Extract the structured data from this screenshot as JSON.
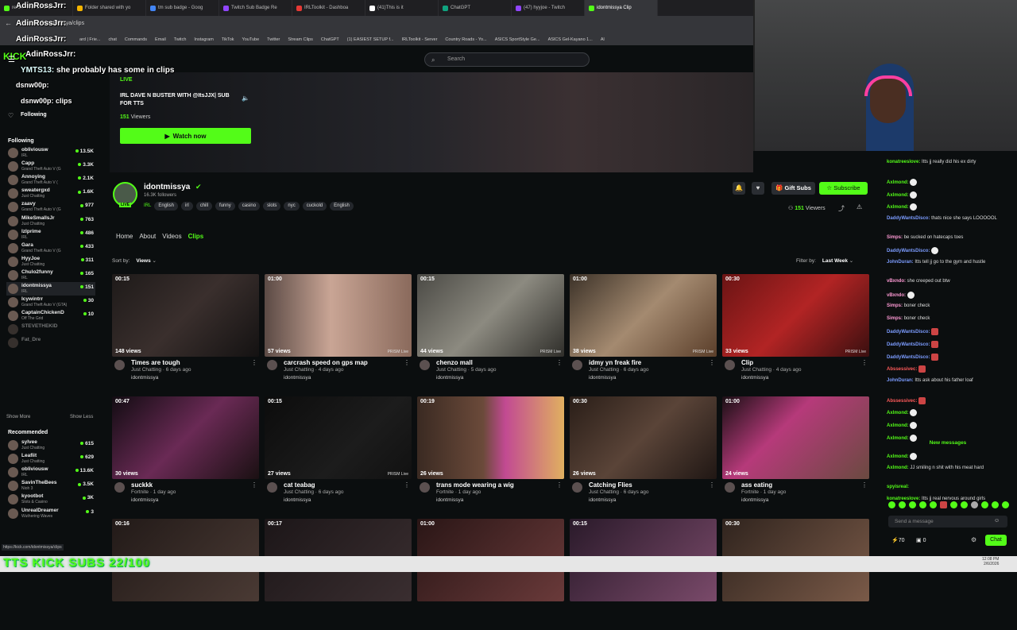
{
  "browser": {
    "tabs": [
      {
        "label": "ream - Kick Dashb",
        "color": "#53fc18"
      },
      {
        "label": "Folder shared with yo",
        "color": "#f4b400"
      },
      {
        "label": "tm sub badge - Goog",
        "color": "#4285f4"
      },
      {
        "label": "Twitch Sub Badge Re",
        "color": "#9146ff"
      },
      {
        "label": "IRLToolkit - Dashboa",
        "color": "#e53935"
      },
      {
        "label": "(41)This is it",
        "color": "#ffffff"
      },
      {
        "label": "ChatGPT",
        "color": "#10a37f"
      },
      {
        "label": "(47) hyyjoe - Twitch",
        "color": "#9146ff"
      },
      {
        "label": "idontmissya Clip",
        "color": "#53fc18"
      }
    ],
    "url": "kick.com/idontmissya/clips",
    "bookmarks": [
      "ard | Frie...",
      "chat",
      "Commands",
      "Email",
      "Twitch",
      "Instagram",
      "TikTok",
      "YouTube",
      "Twitter",
      "Stream Clips",
      "ChatGPT",
      "(1) EASIEST SETUP f...",
      "IRLToolkit - Server",
      "Country Roads - Yo...",
      "ASICS SportStyle Ge...",
      "ASICS Gel-Kayano 1...",
      "Al"
    ]
  },
  "overlay": {
    "alerts": [
      "AdinRossJrr:",
      "AdinRossJrr:",
      "AdinRossJrr:"
    ],
    "chat_user": "YMTS13:",
    "chat_text": "she probably has some in clips",
    "line2_user": "dsnw00p:",
    "line2_text": "clips",
    "kick_logo": "KICK",
    "banner": "TTS KICK SUBS 22/100"
  },
  "search": {
    "placeholder": "Search"
  },
  "sidebar": {
    "followed_label": "Following",
    "section_following": "Following",
    "following": [
      {
        "name": "obliviousw",
        "game": "IRL",
        "viewers": "13.5K"
      },
      {
        "name": "Capp",
        "game": "Grand Theft Auto V (G",
        "viewers": "3.3K"
      },
      {
        "name": "Annoying",
        "game": "Grand Theft Auto V (",
        "viewers": "2.1K"
      },
      {
        "name": "sweatergxd",
        "game": "Just Chatting",
        "viewers": "1.6K"
      },
      {
        "name": "zaavy",
        "game": "Grand Theft Auto V (G",
        "viewers": "977"
      },
      {
        "name": "MikeSmallsJr",
        "game": "Just Chatting",
        "viewers": "763"
      },
      {
        "name": "lzIprime",
        "game": "IRL",
        "viewers": "486"
      },
      {
        "name": "Gara",
        "game": "Grand Theft Auto V (G",
        "viewers": "433"
      },
      {
        "name": "HyyJoe",
        "game": "Just Chatting",
        "viewers": "311"
      },
      {
        "name": "Chulo2funny",
        "game": "IRL",
        "viewers": "165"
      },
      {
        "name": "idontmissya",
        "game": "IRL",
        "viewers": "151"
      },
      {
        "name": "Icywintrr",
        "game": "Grand Theft Auto V (GTA)",
        "viewers": "30"
      },
      {
        "name": "CaptainChickenD",
        "game": "Off The Grid",
        "viewers": "10"
      },
      {
        "name": "STEVETHEKID",
        "game": "",
        "viewers": ""
      },
      {
        "name": "Fat_Dre",
        "game": "",
        "viewers": ""
      }
    ],
    "show_more": "Show More",
    "show_less": "Show Less",
    "section_recommended": "Recommended",
    "recommended": [
      {
        "name": "sylvee",
        "game": "Just Chatting",
        "viewers": "615"
      },
      {
        "name": "Leafiit",
        "game": "Just Chatting",
        "viewers": "629"
      },
      {
        "name": "obliviousw",
        "game": "IRL",
        "viewers": "13.6K"
      },
      {
        "name": "SavinTheBees",
        "game": "Nioh 3",
        "viewers": "3.5K"
      },
      {
        "name": "kyootbot",
        "game": "Slots & Casino",
        "viewers": "3K"
      },
      {
        "name": "UnrealDreamer",
        "game": "Wuthering Waves",
        "viewers": "3"
      }
    ],
    "status_url": "https://kick.com/idontmissya/clips"
  },
  "hero": {
    "live_label": "LIVE",
    "title": "IRL DAVE N BUSTER WITH @ItsJJX| SUB FOR TTS",
    "viewers": "151",
    "viewers_label": "Viewers",
    "watch_label": "Watch now"
  },
  "channel": {
    "name": "idontmissya",
    "followers": "16.3K followers",
    "category": "IRL",
    "tags": [
      "English",
      "irl",
      "chill",
      "funny",
      "casino",
      "slots",
      "nyc",
      "cuckold",
      "English"
    ],
    "avatar_live": "LIVE",
    "gift_label": "Gift Subs",
    "subscribe_label": "Subscribe",
    "live_viewers": "151",
    "live_viewers_label": "Viewers"
  },
  "nav": {
    "tabs": [
      "Home",
      "About",
      "Videos",
      "Clips"
    ],
    "active": "Clips"
  },
  "sort": {
    "label": "Sort by:",
    "value": "Views"
  },
  "filter": {
    "label": "Filter by:",
    "value": "Last Week"
  },
  "clips": [
    {
      "duration": "00:15",
      "views": "148 views",
      "title": "Times are tough",
      "meta": "Just Chatting · 6 days ago",
      "streamer": "idontmissya",
      "prism": "",
      "bg": "linear-gradient(135deg,#1e1a19,#3a2f2d 50%,#141212)"
    },
    {
      "duration": "01:00",
      "views": "57 views",
      "title": "carcrash speed on gps map",
      "meta": "Just Chatting · 4 days ago",
      "streamer": "idontmissya",
      "prism": "PRISM Live",
      "bg": "linear-gradient(90deg,#5b4a45,#c9a595 45%,#8a6a5c)"
    },
    {
      "duration": "00:15",
      "views": "44 views",
      "title": "chenzo mall",
      "meta": "Just Chatting · 5 days ago",
      "streamer": "idontmissya",
      "prism": "PRISM Live",
      "bg": "linear-gradient(135deg,#4b4a45,#8c8a80 50%,#2f2e2a)"
    },
    {
      "duration": "01:00",
      "views": "38 views",
      "title": "idmy yn freak fire",
      "meta": "Just Chatting · 6 days ago",
      "streamer": "idontmissya",
      "prism": "PRISM Live",
      "bg": "linear-gradient(135deg,#3c3228,#a48a70 50%,#5a3e2a)"
    },
    {
      "duration": "00:30",
      "views": "33 views",
      "title": "Clip",
      "meta": "Just Chatting · 4 days ago",
      "streamer": "idontmissya",
      "prism": "PRISM Live",
      "bg": "linear-gradient(135deg,#6a1414,#b22424 50%,#3a0f0f)"
    },
    {
      "duration": "00:47",
      "views": "30 views",
      "title": "suckkk",
      "meta": "Fortnite · 1 day ago",
      "streamer": "idontmissya",
      "prism": "",
      "bg": "linear-gradient(135deg,#120c12,#6a2a55 50%,#1a1012)"
    },
    {
      "duration": "00:15",
      "views": "27 views",
      "title": "cat teabag",
      "meta": "Just Chatting · 6 days ago",
      "streamer": "idontmissya",
      "prism": "PRISM Live",
      "bg": "linear-gradient(135deg,#0c0c0c,#1c1c1c 60%,#111)"
    },
    {
      "duration": "00:19",
      "views": "26 views",
      "title": "trans mode wearing a wig",
      "meta": "Fortnite · 1 day ago",
      "streamer": "idontmissya",
      "prism": "",
      "bg": "linear-gradient(90deg,#3a2a22 0%,#6b4a3a 45%,#c24a92 60%,#e0b060 100%)"
    },
    {
      "duration": "00:30",
      "views": "26 views",
      "title": "Catching Flies",
      "meta": "Just Chatting · 6 days ago",
      "streamer": "idontmissya",
      "prism": "",
      "bg": "linear-gradient(135deg,#2a1e18,#5a4438 50%,#201714)"
    },
    {
      "duration": "01:00",
      "views": "24 views",
      "title": "ass eating",
      "meta": "Fortnite · 1 day ago",
      "streamer": "idontmissya",
      "prism": "",
      "bg": "linear-gradient(135deg,#1a0f14,#b63a7a 40%,#6a4a40)"
    },
    {
      "duration": "00:16",
      "views": "",
      "title": "",
      "meta": "",
      "streamer": "",
      "prism": "",
      "bg": "linear-gradient(135deg,#221a18,#4a3a34)"
    },
    {
      "duration": "00:17",
      "views": "",
      "title": "",
      "meta": "",
      "streamer": "",
      "prism": "",
      "bg": "linear-gradient(135deg,#1c1618,#3a2e30)"
    },
    {
      "duration": "01:00",
      "views": "",
      "title": "",
      "meta": "",
      "streamer": "",
      "prism": "",
      "bg": "linear-gradient(135deg,#2a1616,#6a3a3a)"
    },
    {
      "duration": "00:15",
      "views": "",
      "title": "",
      "meta": "",
      "streamer": "",
      "prism": "",
      "bg": "linear-gradient(135deg,#2a1a2a,#7a4a6a)"
    },
    {
      "duration": "00:30",
      "views": "",
      "title": "",
      "meta": "",
      "streamer": "",
      "prism": "",
      "bg": "linear-gradient(135deg,#30241e,#7a5a48)"
    }
  ],
  "chat": {
    "messages": [
      {
        "user": "konatreeslove:",
        "text": "Itts jj really did his ex dirty",
        "color": "#53fc18",
        "emote": ""
      },
      {
        "user": "Axlmond:",
        "text": "",
        "color": "#53fc18",
        "emote": "w"
      },
      {
        "user": "Axlmond:",
        "text": "",
        "color": "#53fc18",
        "emote": "w"
      },
      {
        "user": "Axlmond:",
        "text": "",
        "color": "#53fc18",
        "emote": "w"
      },
      {
        "user": "DaddyWantsDisco:",
        "text": "thats nice she says LOOOOOL",
        "color": "#7c9cff",
        "emote": ""
      },
      {
        "user": "Simps:",
        "text": "be sucked on hatecaps toes",
        "color": "#ff9ad5",
        "emote": ""
      },
      {
        "user": "DaddyWantsDisco:",
        "text": "",
        "color": "#7c9cff",
        "emote": "w"
      },
      {
        "user": "JohnDuran:",
        "text": "Itts tell jj go to the gym and hustle",
        "color": "#7c9cff",
        "emote": ""
      },
      {
        "user": "vBxndo:",
        "text": "she creeped out btw",
        "color": "#ff9ad5",
        "emote": ""
      },
      {
        "user": "vBxndo:",
        "text": "",
        "color": "#ff9ad5",
        "emote": "w"
      },
      {
        "user": "Simps:",
        "text": "boner check",
        "color": "#ff9ad5",
        "emote": ""
      },
      {
        "user": "Simps:",
        "text": "boner check",
        "color": "#ff9ad5",
        "emote": ""
      },
      {
        "user": "DaddyWantsDisco:",
        "text": "",
        "color": "#7c9cff",
        "emote": "r"
      },
      {
        "user": "DaddyWantsDisco:",
        "text": "",
        "color": "#7c9cff",
        "emote": "r"
      },
      {
        "user": "DaddyWantsDisco:",
        "text": "",
        "color": "#7c9cff",
        "emote": "r"
      },
      {
        "user": "Abssessivec:",
        "text": "",
        "color": "#ff5a5a",
        "emote": "r"
      },
      {
        "user": "JohnDuran:",
        "text": "Itts ask about his father loaf",
        "color": "#7c9cff",
        "emote": ""
      },
      {
        "user": "Abssessivec:",
        "text": "",
        "color": "#ff5a5a",
        "emote": "r"
      },
      {
        "user": "Axlmond:",
        "text": "",
        "color": "#53fc18",
        "emote": "w"
      },
      {
        "user": "Axlmond:",
        "text": "",
        "color": "#53fc18",
        "emote": "w"
      },
      {
        "user": "Axlmond:",
        "text": "",
        "color": "#53fc18",
        "emote": "w"
      }
    ],
    "new_messages": "New messages",
    "after_new": [
      {
        "user": "Axlmond:",
        "text": "",
        "color": "#53fc18",
        "emote": "w"
      },
      {
        "user": "Axlmond:",
        "text": "JJ smiling n shit with his meat hard",
        "color": "#53fc18",
        "emote": ""
      },
      {
        "user": "spyisreal:",
        "text": "",
        "color": "#53fc18",
        "emote": ""
      },
      {
        "user": "konatreeslove:",
        "text": "Itts jj real nervous around girls",
        "color": "#53fc18",
        "emote": ""
      }
    ],
    "input_placeholder": "Send a message",
    "points": "70",
    "points2": "0",
    "chat_button": "Chat"
  },
  "taskbar": {
    "time": "12:08 PM",
    "date": "2/6/2026"
  },
  "colors": {
    "accent": "#53fc18",
    "bg": "#0b0e0f"
  }
}
